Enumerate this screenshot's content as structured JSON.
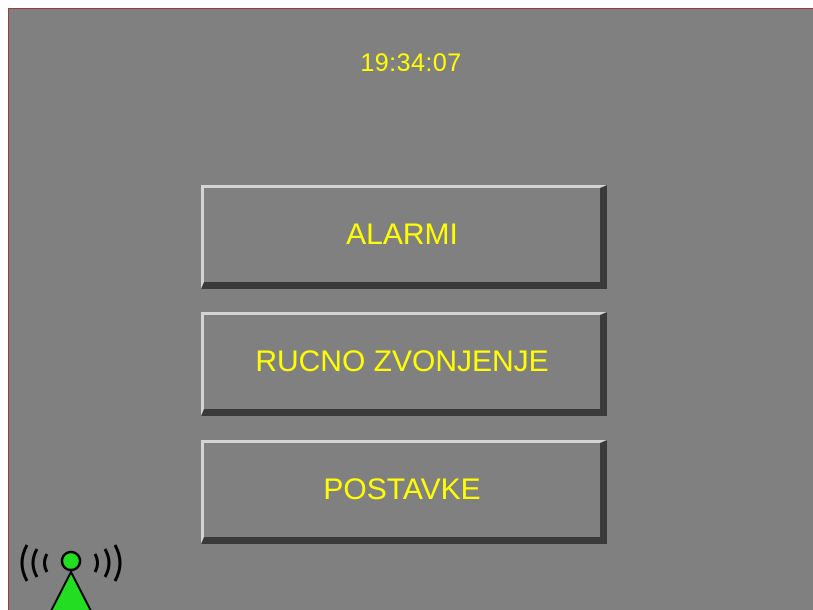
{
  "status": {
    "time": "19:34:07"
  },
  "menu": {
    "buttons": [
      {
        "label": "ALARMI"
      },
      {
        "label": "RUCNO ZVONJENJE"
      },
      {
        "label": "POSTAVKE"
      }
    ]
  },
  "indicator": {
    "icon": "signal-antenna-icon",
    "color": "#22dd22"
  },
  "theme": {
    "background": "#808080",
    "text": "#ffff00"
  }
}
